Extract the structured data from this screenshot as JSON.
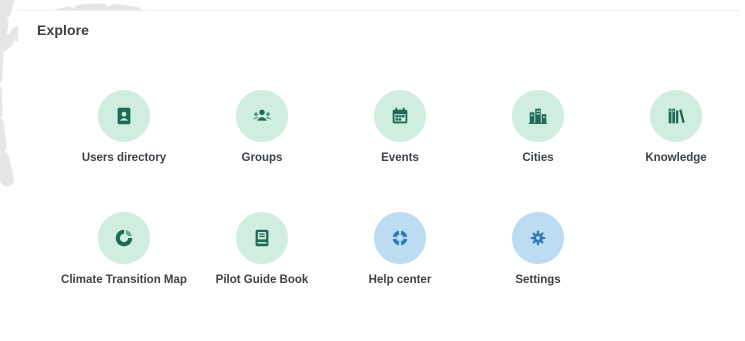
{
  "explore": {
    "title": "Explore",
    "items": [
      {
        "label": "Users directory",
        "icon": "address-book-icon",
        "color": "green"
      },
      {
        "label": "Groups",
        "icon": "users-group-icon",
        "color": "green"
      },
      {
        "label": "Events",
        "icon": "calendar-icon",
        "color": "green"
      },
      {
        "label": "Cities",
        "icon": "city-buildings-icon",
        "color": "green"
      },
      {
        "label": "Knowledge",
        "icon": "books-icon",
        "color": "green"
      },
      {
        "label": "Climate Transition Map",
        "icon": "transition-map-icon",
        "color": "green"
      },
      {
        "label": "Pilot Guide Book",
        "icon": "guide-book-icon",
        "color": "green"
      },
      {
        "label": "Help center",
        "icon": "lifebuoy-icon",
        "color": "blue"
      },
      {
        "label": "Settings",
        "icon": "gear-icon",
        "color": "blue"
      }
    ]
  },
  "colors": {
    "green_bg": "#cfeee0",
    "green_icon": "#1f6a57",
    "blue_bg": "#bcdcf2",
    "blue_icon": "#2f79b8"
  }
}
